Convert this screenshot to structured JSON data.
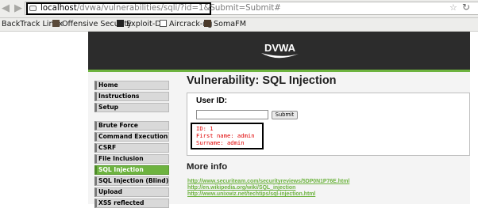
{
  "browser": {
    "url_host": "localhost",
    "url_path": "/dvwa/vulnerabilities/sqli/?id=1&Submit=Submit#",
    "bookmarks": [
      {
        "label": "BackTrack Linux",
        "icon": "backtrack-icon"
      },
      {
        "label": "Offensive Security",
        "icon": "offensive-security-icon"
      },
      {
        "label": "Exploit-DB",
        "icon": "exploit-db-icon"
      },
      {
        "label": "Aircrack-ng",
        "icon": "aircrack-icon"
      },
      {
        "label": "SomaFM",
        "icon": "somafm-icon"
      }
    ]
  },
  "header": {
    "logo_text": "DVWA",
    "accent_color": "#6db33f",
    "header_color": "#2c2c2c"
  },
  "menu": {
    "items": [
      {
        "label": "Home"
      },
      {
        "label": "Instructions"
      },
      {
        "label": "Setup"
      },
      {
        "label": "Brute Force"
      },
      {
        "label": "Command Execution"
      },
      {
        "label": "CSRF"
      },
      {
        "label": "File Inclusion"
      },
      {
        "label": "SQL Injection",
        "selected": true
      },
      {
        "label": "SQL Injection (Blind)"
      },
      {
        "label": "Upload"
      },
      {
        "label": "XSS reflected"
      }
    ]
  },
  "main": {
    "title": "Vulnerability: SQL Injection",
    "form": {
      "label": "User ID:",
      "input_value": "",
      "submit_label": "Submit"
    },
    "result": {
      "id": "ID: 1",
      "first_name": "First name: admin",
      "surname": "Surname: admin"
    },
    "more_info": {
      "title": "More info",
      "links": [
        "http://www.securiteam.com/securityreviews/5DP0N1P76E.html",
        "http://en.wikipedia.org/wiki/SQL_injection",
        "http://www.unixwiz.net/techtips/sql-injection.html"
      ]
    }
  }
}
